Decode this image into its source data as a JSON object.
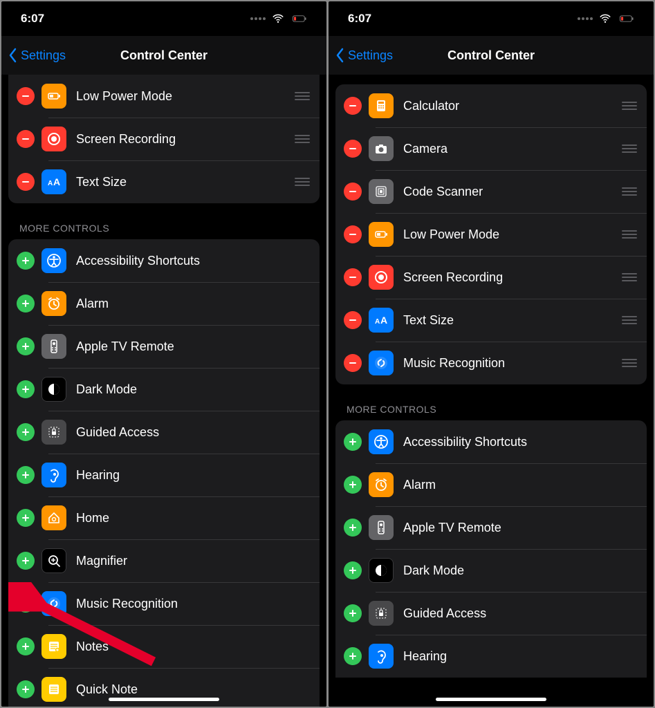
{
  "statusbar": {
    "time": "6:07"
  },
  "nav": {
    "back": "Settings",
    "title": "Control Center"
  },
  "headers": {
    "more_controls": "MORE CONTROLS"
  },
  "left": {
    "included": [
      {
        "label": "Low Power Mode",
        "icon": "lowpower",
        "bg": "bg-orange"
      },
      {
        "label": "Screen Recording",
        "icon": "record",
        "bg": "bg-red"
      },
      {
        "label": "Text Size",
        "icon": "textsize",
        "bg": "bg-blue"
      }
    ],
    "more": [
      {
        "label": "Accessibility Shortcuts",
        "icon": "accessibility",
        "bg": "bg-blue"
      },
      {
        "label": "Alarm",
        "icon": "alarm",
        "bg": "bg-orange"
      },
      {
        "label": "Apple TV Remote",
        "icon": "remote",
        "bg": "bg-grey2"
      },
      {
        "label": "Dark Mode",
        "icon": "darkmode",
        "bg": "bg-black"
      },
      {
        "label": "Guided Access",
        "icon": "guided",
        "bg": "bg-dgrey"
      },
      {
        "label": "Hearing",
        "icon": "hearing",
        "bg": "bg-blue"
      },
      {
        "label": "Home",
        "icon": "home",
        "bg": "bg-orange"
      },
      {
        "label": "Magnifier",
        "icon": "magnifier",
        "bg": "bg-black"
      },
      {
        "label": "Music Recognition",
        "icon": "shazam",
        "bg": "bg-blue"
      },
      {
        "label": "Notes",
        "icon": "notes",
        "bg": "bg-yellow"
      },
      {
        "label": "Quick Note",
        "icon": "quicknote",
        "bg": "bg-yellow"
      }
    ]
  },
  "right": {
    "included": [
      {
        "label": "Calculator",
        "icon": "calculator",
        "bg": "bg-orange"
      },
      {
        "label": "Camera",
        "icon": "camera",
        "bg": "bg-grey2"
      },
      {
        "label": "Code Scanner",
        "icon": "scanner",
        "bg": "bg-grey2"
      },
      {
        "label": "Low Power Mode",
        "icon": "lowpower",
        "bg": "bg-orange"
      },
      {
        "label": "Screen Recording",
        "icon": "record",
        "bg": "bg-red"
      },
      {
        "label": "Text Size",
        "icon": "textsize",
        "bg": "bg-blue"
      },
      {
        "label": "Music Recognition",
        "icon": "shazam",
        "bg": "bg-blue"
      }
    ],
    "more": [
      {
        "label": "Accessibility Shortcuts",
        "icon": "accessibility",
        "bg": "bg-blue"
      },
      {
        "label": "Alarm",
        "icon": "alarm",
        "bg": "bg-orange"
      },
      {
        "label": "Apple TV Remote",
        "icon": "remote",
        "bg": "bg-grey2"
      },
      {
        "label": "Dark Mode",
        "icon": "darkmode",
        "bg": "bg-black"
      },
      {
        "label": "Guided Access",
        "icon": "guided",
        "bg": "bg-dgrey"
      },
      {
        "label": "Hearing",
        "icon": "hearing",
        "bg": "bg-blue"
      }
    ]
  }
}
